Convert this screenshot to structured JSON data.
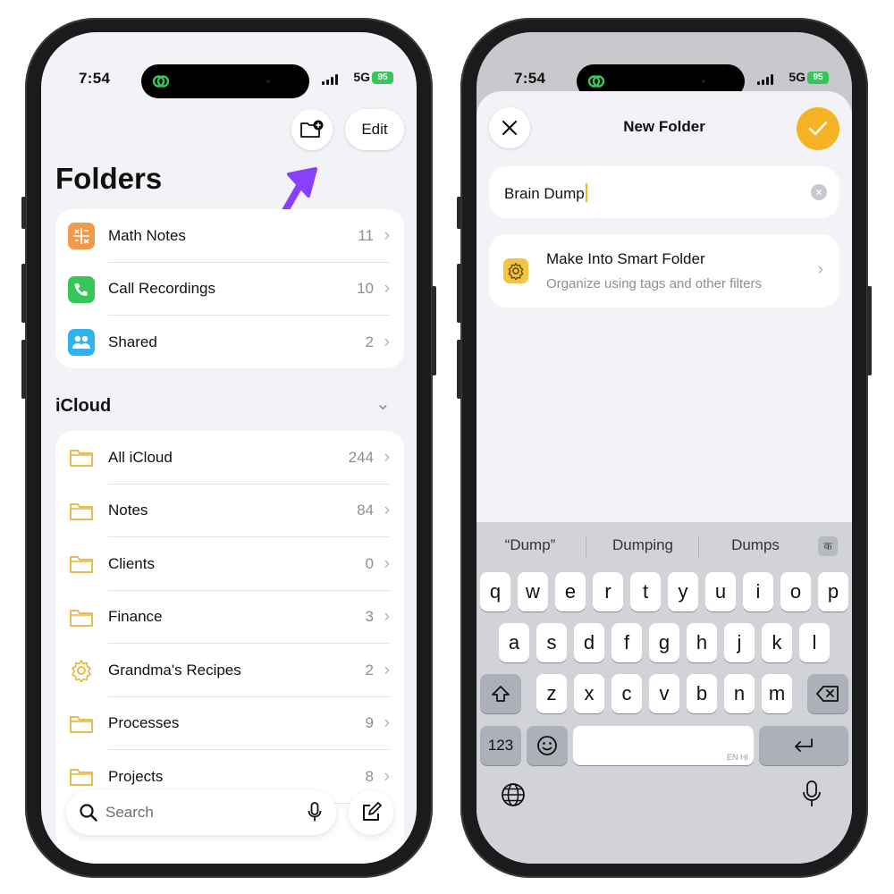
{
  "left_screen": {
    "status": {
      "time": "7:54",
      "network": "5G",
      "battery": "95"
    },
    "toolbar": {
      "edit_label": "Edit"
    },
    "title": "Folders",
    "pinned_folders": [
      {
        "label": "Math Notes",
        "count": "11",
        "icon": "math-notes-icon"
      },
      {
        "label": "Call Recordings",
        "count": "10",
        "icon": "phone-icon"
      },
      {
        "label": "Shared",
        "count": "2",
        "icon": "people-icon"
      }
    ],
    "section_title": "iCloud",
    "icloud_folders": [
      {
        "label": "All iCloud",
        "count": "244",
        "icon": "folder-icon"
      },
      {
        "label": "Notes",
        "count": "84",
        "icon": "folder-icon"
      },
      {
        "label": "Clients",
        "count": "0",
        "icon": "folder-icon"
      },
      {
        "label": "Finance",
        "count": "3",
        "icon": "folder-icon"
      },
      {
        "label": "Grandma's Recipes",
        "count": "2",
        "icon": "gear-icon"
      },
      {
        "label": "Processes",
        "count": "9",
        "icon": "folder-icon"
      },
      {
        "label": "Projects",
        "count": "8",
        "icon": "folder-icon"
      }
    ],
    "search": {
      "placeholder": "Search"
    },
    "annotation_color": "#8a3ffc"
  },
  "right_screen": {
    "status": {
      "time": "7:54",
      "network": "5G",
      "battery": "95"
    },
    "sheet_title": "New Folder",
    "folder_name": "Brain Dump",
    "smart_folder": {
      "title": "Make Into Smart Folder",
      "subtitle": "Organize using tags and other filters"
    },
    "suggestions": [
      "“Dump”",
      "Dumping",
      "Dumps"
    ],
    "language_chip": "क",
    "keyboard": {
      "row1": [
        "q",
        "w",
        "e",
        "r",
        "t",
        "y",
        "u",
        "i",
        "o",
        "p"
      ],
      "row2": [
        "a",
        "s",
        "d",
        "f",
        "g",
        "h",
        "j",
        "k",
        "l"
      ],
      "row3": [
        "z",
        "x",
        "c",
        "v",
        "b",
        "n",
        "m"
      ],
      "numbers_label": "123",
      "space_hint": "EN HI"
    },
    "accent_color": "#f5b324"
  }
}
